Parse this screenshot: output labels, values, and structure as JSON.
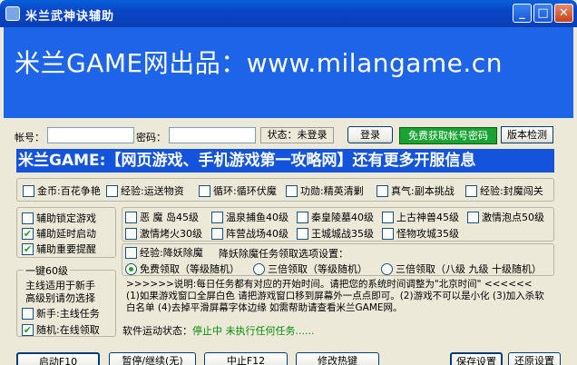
{
  "window": {
    "title": "米兰武神诀辅助",
    "min": "_",
    "max": "□",
    "close": "✕"
  },
  "banner": {
    "text": "米兰GAME网出品：www.milangame.cn"
  },
  "login": {
    "account_label": "帐号：",
    "password_label": "密码：",
    "status_text": "状态：未登录",
    "login_button": "登录",
    "free_account_button": "免费获取帐号密码",
    "version_button": "版本检测"
  },
  "headline": "米兰GAME:【网页游戏、手机游戏第一攻略网】还有更多开服信息",
  "tasks": [
    {
      "label": "金币:百花争艳",
      "checked": false
    },
    {
      "label": "经验:运送物资",
      "checked": false
    },
    {
      "label": "循环:循环伏魔",
      "checked": false
    },
    {
      "label": "功勋:精英清剿",
      "checked": false
    },
    {
      "label": "真气:副本挑战",
      "checked": false
    },
    {
      "label": "经验:封魔闯关",
      "checked": false
    }
  ],
  "aux": [
    {
      "label": "辅助锁定游戏",
      "checked": false
    },
    {
      "label": "辅助延时启动",
      "checked": true
    },
    {
      "label": "辅助重要提醒",
      "checked": true
    }
  ],
  "oneclick": {
    "title": "一键60级",
    "desc": "主线适用于新手\n高级别请勿选择",
    "items": [
      {
        "label": "新手:主线任务",
        "checked": false
      },
      {
        "label": "随机:在线领取",
        "checked": true
      }
    ]
  },
  "monsters": [
    {
      "label": "恶 魔 岛45级",
      "checked": false
    },
    {
      "label": "温泉捕鱼40级",
      "checked": false
    },
    {
      "label": "秦皇陵墓40级",
      "checked": false
    },
    {
      "label": "上古神兽45级",
      "checked": false
    },
    {
      "label": "激情泡点50级",
      "checked": false
    },
    {
      "label": "激情烤火30级",
      "checked": false
    },
    {
      "label": "阵营战场40级",
      "checked": false
    },
    {
      "label": "王城城战35级",
      "checked": false
    },
    {
      "label": "怪物攻城35级",
      "checked": false
    }
  ],
  "demon": {
    "checkbox_label": "经验:降妖除魔",
    "checked": false,
    "settings_label": "降妖除魔任务领取选项设置：",
    "options": [
      {
        "label": "免费领取（等级随机）",
        "selected": true
      },
      {
        "label": "三倍领取（等级随机）",
        "selected": false
      },
      {
        "label": "三倍领取（八级 九级 十级随机）",
        "selected": false
      }
    ]
  },
  "notice": ">>>>>>说明:每日任务都有对应的开始时间。请把您的系统时间调整为\"北京时间\" <<<<<<\n(1)如果游戏窗口全屏白色 请把游戏窗口移到屏幕外一点点即可。(2)游戏不可以是小化 (3)加入杀软白名单 (4)去掉平滑屏幕字体边缘 如需帮助请查看米兰GAME网。",
  "run_status": {
    "label": "软件运动状态：",
    "value": "停止中 未执行任何任务......"
  },
  "footer": {
    "start": "启动F10",
    "pause": "暂停/继续(无)",
    "stop": "中止F12",
    "hotkey": "修改热键",
    "save": "保存设置",
    "restore": "还原设置"
  },
  "colors": {
    "title_bar": "#0846c7",
    "banner": "#1e64e8",
    "headline": "#1454dc",
    "green_button": "#18a332",
    "status_green": "#0a8a0a"
  }
}
